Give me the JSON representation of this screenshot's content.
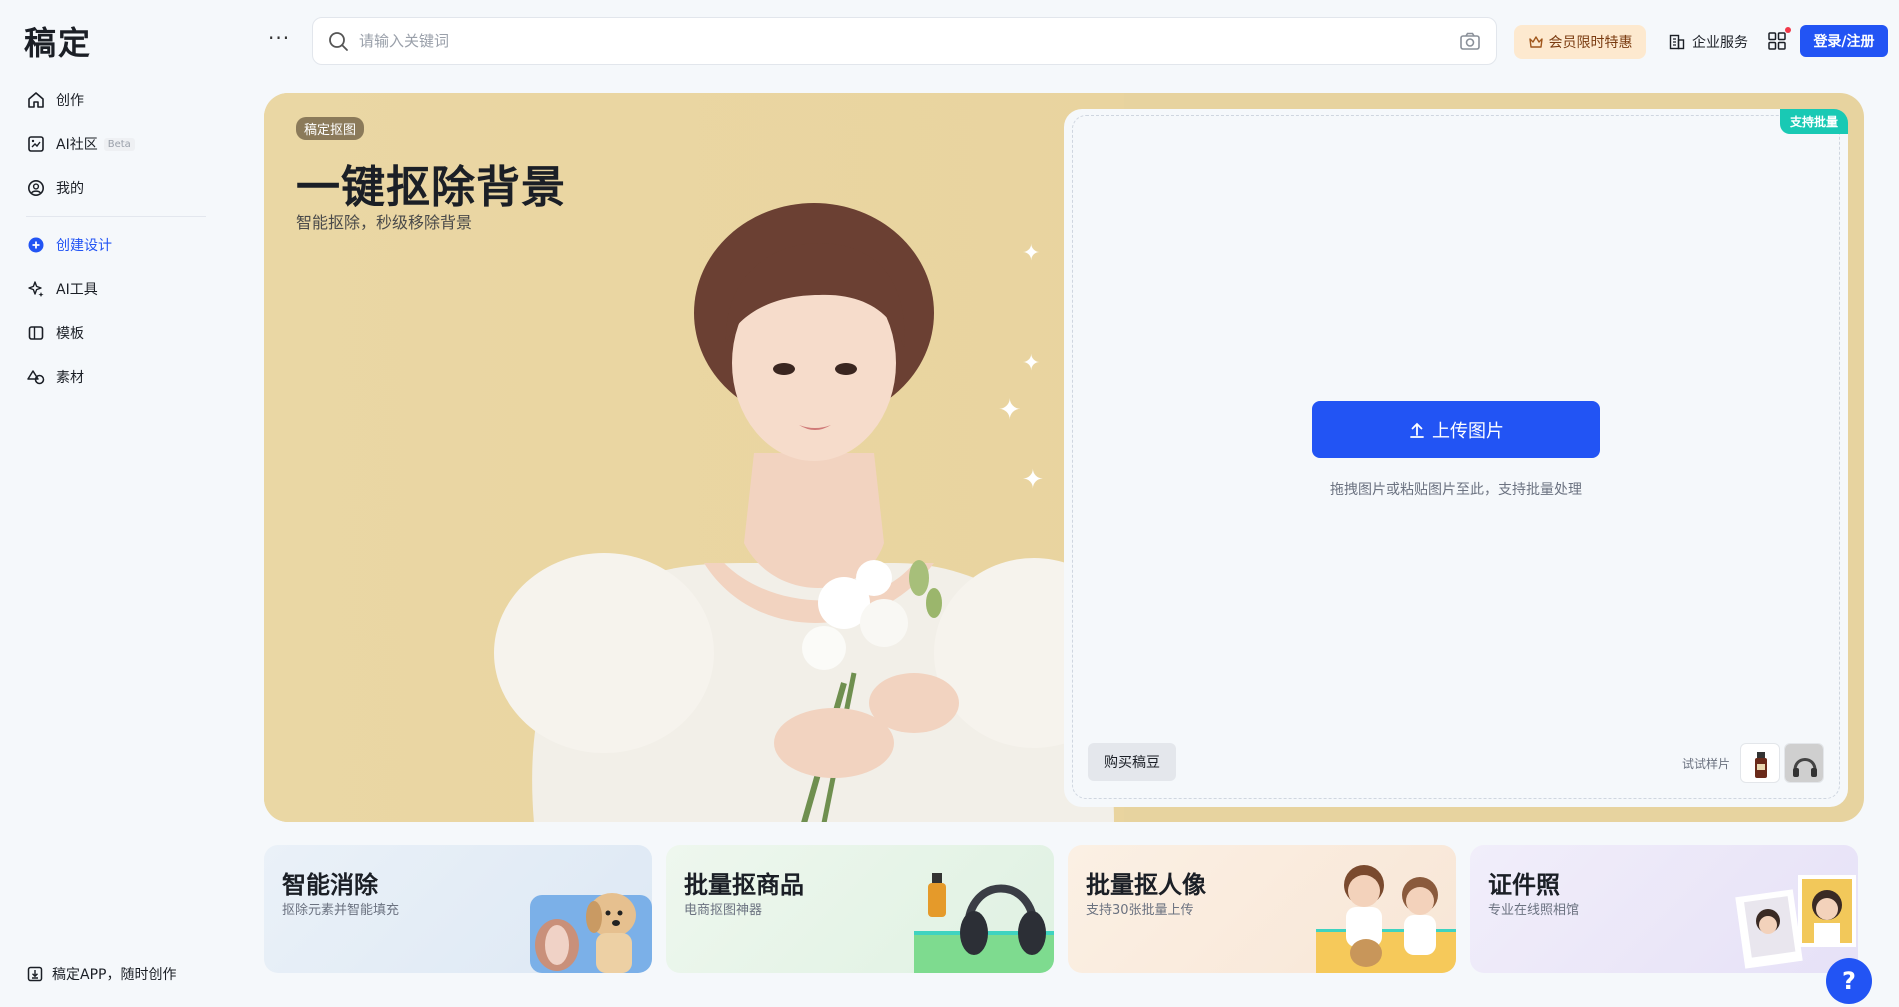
{
  "app": {
    "logo": "稿定"
  },
  "sidebar": {
    "items_top": [
      {
        "label": "创作",
        "icon": "home-icon"
      },
      {
        "label": "AI社区",
        "icon": "ai-community-icon",
        "badge": "Beta"
      },
      {
        "label": "我的",
        "icon": "user-icon"
      }
    ],
    "items_bottom": [
      {
        "label": "创建设计",
        "icon": "plus-circle-icon",
        "active": true
      },
      {
        "label": "AI工具",
        "icon": "sparkle-icon"
      },
      {
        "label": "模板",
        "icon": "template-icon"
      },
      {
        "label": "素材",
        "icon": "material-icon"
      }
    ],
    "app_download": "稿定APP，随时创作"
  },
  "header": {
    "more": "···",
    "search_placeholder": "请输入关键词",
    "vip_label": "会员限时特惠",
    "enterprise_label": "企业服务",
    "login_label": "登录/注册"
  },
  "hero": {
    "tag": "稿定抠图",
    "title": "一键抠除背景",
    "subtitle": "智能抠除，秒级移除背景",
    "batch_badge": "支持批量",
    "upload_label": "上传图片",
    "upload_hint": "拖拽图片或粘贴图片至此，支持批量处理",
    "buy_label": "购买稿豆",
    "sample_label": "试试样片"
  },
  "features": [
    {
      "title": "智能消除",
      "subtitle": "抠除元素并智能填充"
    },
    {
      "title": "批量抠商品",
      "subtitle": "电商抠图神器"
    },
    {
      "title": "批量抠人像",
      "subtitle": "支持30张批量上传"
    },
    {
      "title": "证件照",
      "subtitle": "专业在线照相馆"
    }
  ],
  "help_label": "?",
  "colors": {
    "accent": "#2254f4",
    "hero_bg": "#e7d39f",
    "badge_teal": "#19c9b4",
    "vip_bg": "#fde9cf"
  }
}
